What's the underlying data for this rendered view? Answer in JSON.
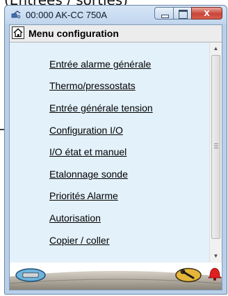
{
  "caption": "(Entrées / sorties)",
  "window": {
    "title": "00:000 AK-CC 750A",
    "buttons": {
      "close": "x"
    }
  },
  "menu": {
    "title": "Menu configuration",
    "items": [
      {
        "label": "Entrée alarme générale"
      },
      {
        "label": "Thermo/pressostats"
      },
      {
        "label": "Entrée générale tension"
      },
      {
        "label": "Configuration I/O"
      },
      {
        "label": "I/O  état et manuel"
      },
      {
        "label": "Etalonnage sonde"
      },
      {
        "label": "Priorités Alarme"
      },
      {
        "label": "Autorisation"
      },
      {
        "label": "Copier / coller"
      }
    ]
  },
  "icons": {
    "window": "app-network-icon",
    "home": "home-icon",
    "left_bottom": "keyboard-icon",
    "right_bottom": "wrench-icon",
    "alarm": "alarm-bell-icon",
    "scroll_up": "scroll-up-arrow-icon",
    "scroll_down": "scroll-down-arrow-icon"
  },
  "colors": {
    "content_bg": "#e3f1fb",
    "close_button": "#c9443a",
    "alarm": "#e02020",
    "wrench_badge": "#e5b53a",
    "keyboard_badge": "#6fb4dc"
  }
}
